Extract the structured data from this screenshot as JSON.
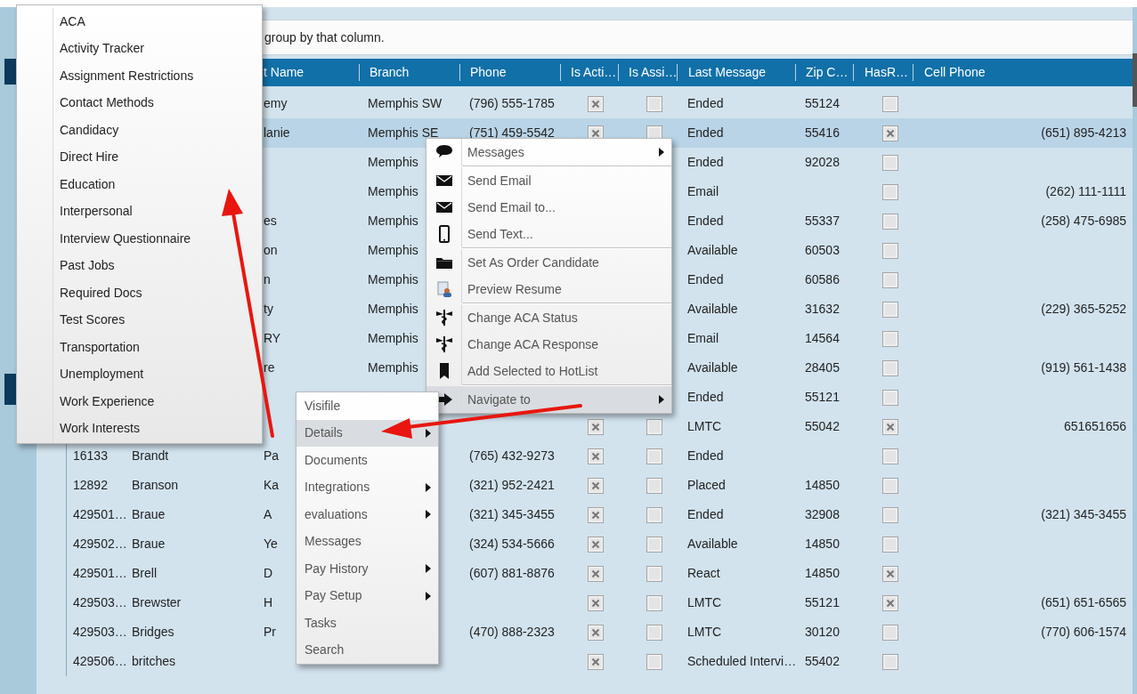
{
  "group_hint": "group by that column.",
  "table": {
    "columns": [
      {
        "kind": "text"
      },
      {
        "kind": "text"
      },
      {
        "kind": "text",
        "label": "t Name"
      },
      {
        "kind": "text",
        "label": "Branch"
      },
      {
        "kind": "text",
        "label": "Phone"
      },
      {
        "kind": "check",
        "label": "Is Acti…"
      },
      {
        "kind": "check",
        "label": "Is Assi…"
      },
      {
        "kind": "text",
        "label": "Last Message"
      },
      {
        "kind": "text",
        "label": "Zip C…"
      },
      {
        "kind": "check",
        "label": "HasR…"
      },
      {
        "kind": "text",
        "label": "Cell Phone"
      }
    ],
    "rows": [
      {
        "selected": false,
        "cells": [
          null,
          null,
          "emy",
          "Memphis SW",
          "(796) 555-1785",
          {
            "checked": true
          },
          {
            "checked": false
          },
          "Ended",
          "55124",
          {
            "checked": false
          },
          null
        ]
      },
      {
        "selected": true,
        "cells": [
          null,
          null,
          "lanie",
          "Memphis SE",
          "(751) 459-5542",
          {
            "checked": true
          },
          {
            "checked": false
          },
          "Ended",
          "55416",
          {
            "checked": true
          },
          "(651) 895-4213"
        ]
      },
      {
        "selected": false,
        "cells": [
          null,
          null,
          null,
          "Memphis",
          null,
          null,
          null,
          "Ended",
          "92028",
          {
            "checked": false
          },
          null
        ]
      },
      {
        "selected": false,
        "cells": [
          null,
          null,
          null,
          "Memphis",
          null,
          null,
          null,
          "Email",
          null,
          {
            "checked": false
          },
          "(262) 111-1111"
        ]
      },
      {
        "selected": false,
        "cells": [
          null,
          null,
          "es",
          "Memphis",
          null,
          null,
          null,
          "Ended",
          "55337",
          {
            "checked": false
          },
          "(258) 475-6985"
        ]
      },
      {
        "selected": false,
        "cells": [
          null,
          null,
          "on",
          "Memphis",
          null,
          null,
          null,
          "Available",
          "60503",
          {
            "checked": false
          },
          null
        ]
      },
      {
        "selected": false,
        "cells": [
          null,
          null,
          "n",
          "Memphis",
          null,
          null,
          null,
          "Ended",
          "60586",
          {
            "checked": false
          },
          null
        ]
      },
      {
        "selected": false,
        "cells": [
          null,
          null,
          "ty",
          "Memphis",
          null,
          null,
          null,
          "Available",
          "31632",
          {
            "checked": false
          },
          "(229) 365-5252"
        ]
      },
      {
        "selected": false,
        "cells": [
          null,
          null,
          "RY",
          "Memphis",
          null,
          null,
          null,
          "Email",
          "14564",
          {
            "checked": false
          },
          null
        ]
      },
      {
        "selected": false,
        "cells": [
          null,
          null,
          "re",
          "Memphis",
          null,
          null,
          null,
          "Available",
          "28405",
          {
            "checked": false
          },
          "(919) 561-1438"
        ]
      },
      {
        "selected": false,
        "cells": [
          null,
          null,
          null,
          null,
          null,
          null,
          null,
          "Ended",
          "55121",
          {
            "checked": false
          },
          null
        ]
      },
      {
        "selected": false,
        "cells": [
          null,
          null,
          null,
          null,
          null,
          {
            "checked": true
          },
          {
            "checked": false
          },
          "LMTC",
          "55042",
          {
            "checked": true
          },
          "651651656"
        ]
      },
      {
        "selected": false,
        "cells": [
          "16133",
          "Brandt",
          "Pa",
          null,
          "(765) 432-9273",
          {
            "checked": true
          },
          {
            "checked": false
          },
          "Ended",
          null,
          {
            "checked": false
          },
          null
        ]
      },
      {
        "selected": false,
        "cells": [
          "12892",
          "Branson",
          "Ka",
          null,
          "(321) 952-2421",
          {
            "checked": true
          },
          {
            "checked": false
          },
          "Placed",
          "14850",
          {
            "checked": false
          },
          null
        ]
      },
      {
        "selected": false,
        "cells": [
          "429501…",
          "Braue",
          "A",
          null,
          "(321) 345-3455",
          {
            "checked": true
          },
          {
            "checked": false
          },
          "Ended",
          "32908",
          {
            "checked": false
          },
          "(321) 345-3455"
        ]
      },
      {
        "selected": false,
        "cells": [
          "429502…",
          "Braue",
          "Ye",
          null,
          "(324) 534-5666",
          {
            "checked": true
          },
          {
            "checked": false
          },
          "Available",
          "14850",
          {
            "checked": false
          },
          null
        ]
      },
      {
        "selected": false,
        "cells": [
          "429501…",
          "Brell",
          "D",
          null,
          "(607) 881-8876",
          {
            "checked": true
          },
          {
            "checked": false
          },
          "React",
          "14850",
          {
            "checked": true
          },
          null
        ]
      },
      {
        "selected": false,
        "cells": [
          "429503…",
          "Brewster",
          "H",
          null,
          null,
          {
            "checked": true
          },
          {
            "checked": false
          },
          "LMTC",
          "55121",
          {
            "checked": true
          },
          "(651) 651-6565"
        ]
      },
      {
        "selected": false,
        "cells": [
          "429503…",
          "Bridges",
          "Pr",
          null,
          "(470) 888-2323",
          {
            "checked": true
          },
          {
            "checked": false
          },
          "LMTC",
          "30120",
          {
            "checked": false
          },
          "(770) 606-1574"
        ]
      },
      {
        "selected": false,
        "cells": [
          "429506…",
          "britches",
          null,
          null,
          null,
          {
            "checked": true
          },
          {
            "checked": false
          },
          "Scheduled Intervi…",
          "55402",
          {
            "checked": false
          },
          null
        ]
      }
    ]
  },
  "details_menu": {
    "items": [
      {
        "label": "ACA",
        "selected": false
      },
      {
        "label": "Activity Tracker",
        "selected": false
      },
      {
        "label": "Assignment Restrictions",
        "selected": false
      },
      {
        "label": "Contact Methods",
        "selected": false
      },
      {
        "label": "Candidacy",
        "selected": false
      },
      {
        "label": "Direct Hire",
        "selected": false
      },
      {
        "label": "Education",
        "selected": false
      },
      {
        "label": "Interpersonal",
        "selected": false
      },
      {
        "label": "Interview Questionnaire",
        "selected": false
      },
      {
        "label": "Past Jobs",
        "selected": false
      },
      {
        "label": "Required Docs",
        "selected": false
      },
      {
        "label": "Test Scores",
        "selected": false
      },
      {
        "label": "Transportation",
        "selected": false
      },
      {
        "label": "Unemployment",
        "selected": false
      },
      {
        "label": "Work Experience",
        "selected": false
      },
      {
        "label": "Work Interests",
        "selected": false
      }
    ]
  },
  "context_menu": {
    "items": [
      {
        "kind": "item",
        "label": "Messages",
        "submenu": true,
        "selected": false
      },
      {
        "kind": "separator"
      },
      {
        "kind": "item",
        "label": "Send Email",
        "submenu": false,
        "selected": false
      },
      {
        "kind": "item",
        "label": "Send Email to...",
        "submenu": false,
        "selected": false
      },
      {
        "kind": "item",
        "label": "Send Text...",
        "submenu": false,
        "selected": false
      },
      {
        "kind": "separator"
      },
      {
        "kind": "item",
        "label": "Set As Order Candidate",
        "submenu": false,
        "selected": false
      },
      {
        "kind": "item",
        "label": "Preview Resume",
        "submenu": false,
        "selected": false
      },
      {
        "kind": "separator"
      },
      {
        "kind": "item",
        "label": "Change ACA Status",
        "submenu": false,
        "selected": false
      },
      {
        "kind": "item",
        "label": "Change ACA Response",
        "submenu": false,
        "selected": false
      },
      {
        "kind": "item",
        "label": "Add Selected to HotList",
        "submenu": false,
        "selected": false
      },
      {
        "kind": "separator"
      },
      {
        "kind": "item",
        "label": "Navigate to",
        "submenu": true,
        "selected": true
      }
    ]
  },
  "navigate_menu": {
    "items": [
      {
        "label": "Visifile",
        "submenu": false,
        "selected": false
      },
      {
        "label": "Details",
        "submenu": true,
        "selected": true
      },
      {
        "label": "Documents",
        "submenu": false,
        "selected": false
      },
      {
        "label": "Integrations",
        "submenu": true,
        "selected": false
      },
      {
        "label": "evaluations",
        "submenu": true,
        "selected": false
      },
      {
        "label": "Messages",
        "submenu": false,
        "selected": false
      },
      {
        "label": "Pay History",
        "submenu": true,
        "selected": false
      },
      {
        "label": "Pay Setup",
        "submenu": true,
        "selected": false
      },
      {
        "label": "Tasks",
        "submenu": false,
        "selected": false
      },
      {
        "label": "Search",
        "submenu": false,
        "selected": false
      }
    ]
  }
}
